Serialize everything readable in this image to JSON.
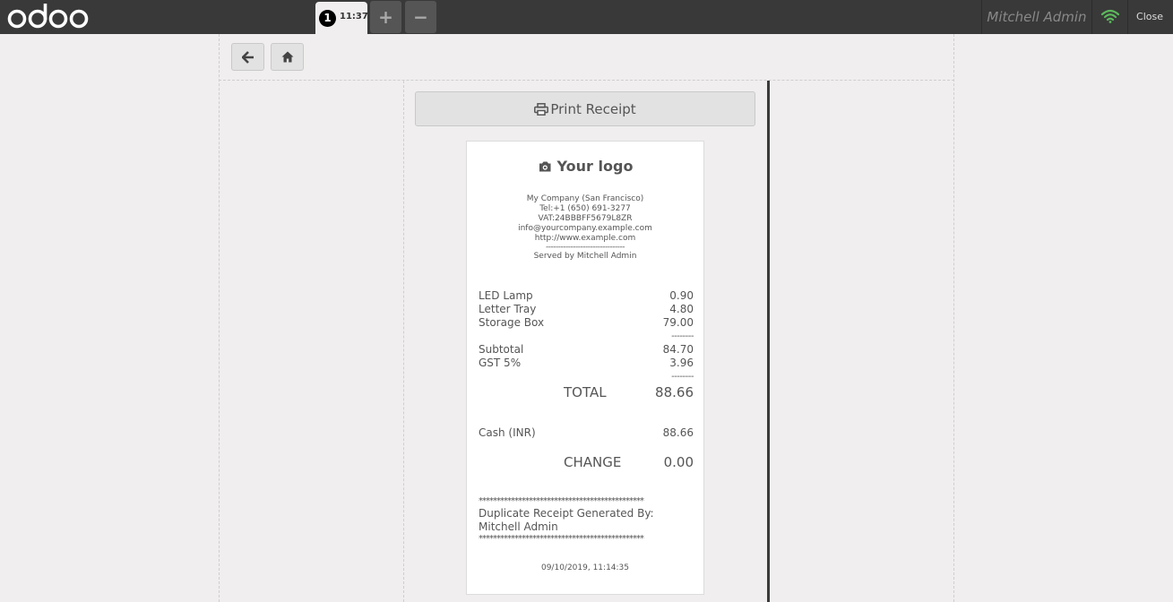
{
  "brand": {
    "logo_text": "odoo"
  },
  "order_tab": {
    "number": "1",
    "time": "11:37"
  },
  "tabs": {
    "add_label": "+",
    "remove_label": "−"
  },
  "header": {
    "user_name": "Mitchell Admin",
    "close_label": "Close"
  },
  "print_button": {
    "label": "Print Receipt"
  },
  "receipt": {
    "logo_label": "Your logo",
    "company": {
      "name": "My Company (San Francisco)",
      "tel": "Tel:+1 (650) 691-3277",
      "vat": "VAT:24BBBFF5679L8ZR",
      "email": "info@yourcompany.example.com",
      "website": "http://www.example.com",
      "separator": "--------------------------------",
      "served_by": "Served by Mitchell Admin"
    },
    "lines": [
      {
        "product": "LED Lamp",
        "price": "0.90"
      },
      {
        "product": "Letter Tray",
        "price": "4.80"
      },
      {
        "product": "Storage Box",
        "price": "79.00"
      }
    ],
    "dash_separator": "--------",
    "subtotal_label": "Subtotal",
    "subtotal_value": "84.70",
    "tax_label": "GST 5%",
    "tax_value": "3.96",
    "total_label": "TOTAL",
    "total_value": "88.66",
    "payment_label": "Cash (INR)",
    "payment_value": "88.66",
    "change_label": "CHANGE",
    "change_value": "0.00",
    "stars": "**********************************************",
    "duplicate_note": "Duplicate Receipt Generated By: Mitchell Admin",
    "date": "09/10/2019, 11:14:35"
  },
  "colors": {
    "topbar": "#393939",
    "background": "#f0eeee",
    "wifi": "#5cb85c"
  }
}
